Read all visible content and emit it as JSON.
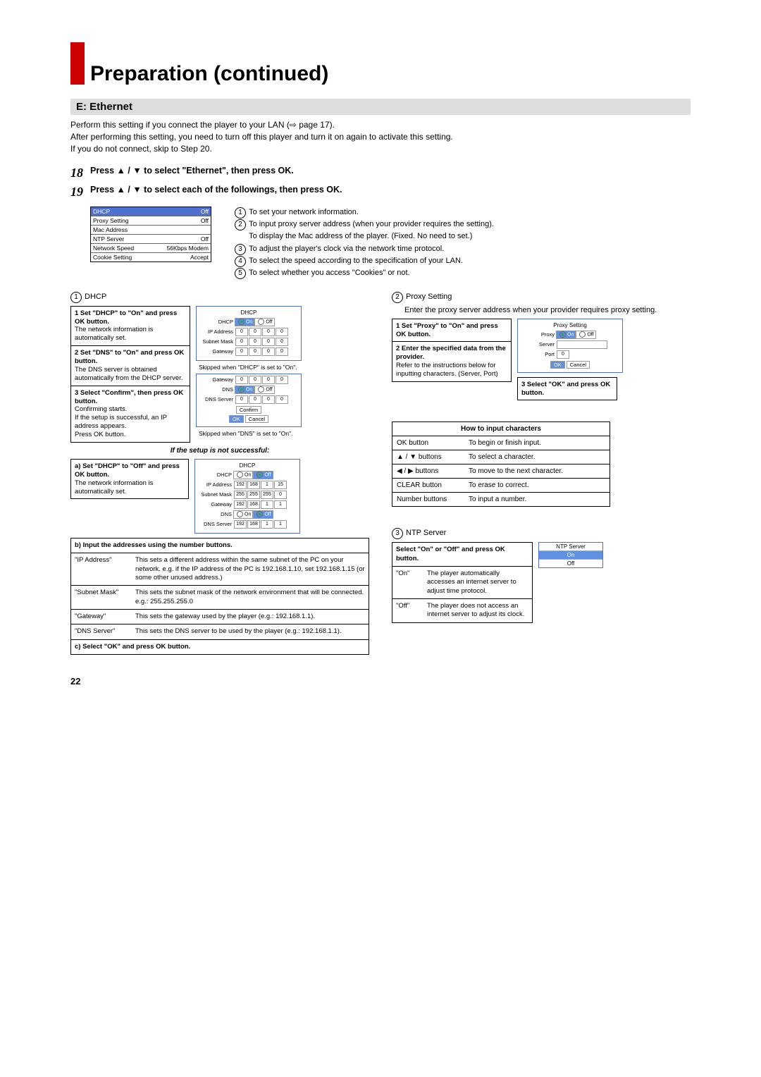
{
  "title": "Preparation (continued)",
  "section": "E: Ethernet",
  "intro": {
    "l1": "Perform this setting if you connect the player to your LAN (⇨ page 17).",
    "l2": "After performing this setting, you need to turn off this player and turn it on again to activate this setting.",
    "l3": "If you do not connect, skip to Step 20."
  },
  "step18": {
    "num": "18",
    "text": "Press ▲ / ▼ to select \"Ethernet\", then press OK."
  },
  "step19": {
    "num": "19",
    "text": "Press ▲ / ▼ to select each of the followings, then press OK."
  },
  "menu": {
    "rows": [
      {
        "l": "DHCP",
        "r": "Off"
      },
      {
        "l": "Proxy Setting",
        "r": "Off"
      },
      {
        "l": "Mac Address",
        "r": ""
      },
      {
        "l": "NTP Server",
        "r": "Off"
      },
      {
        "l": "Network Speed",
        "r": "56Kbps Modem"
      },
      {
        "l": "Cookie Setting",
        "r": "Accept"
      }
    ]
  },
  "desc": {
    "d1": "To set your network information.",
    "d2": "To input proxy server address (when your provider requires the setting).",
    "d_mac": "To display the Mac address of the player. (Fixed. No need to set.)",
    "d3": "To adjust the player's clock via the network time protocol.",
    "d4": "To select the speed according to the specification of your LAN.",
    "d5": "To select whether you access \"Cookies\" or not."
  },
  "dhcp": {
    "label": "DHCP",
    "s1_t": "1  Set \"DHCP\" to \"On\" and press OK button.",
    "s1_b": "The network information is automatically set.",
    "s2_t": "2  Set \"DNS\" to \"On\" and press OK button.",
    "s2_b": "The DNS server is obtained automatically from the DHCP server.",
    "s3_t": "3  Select \"Confirm\", then press OK button.",
    "s3_b": "Confirming starts.\nIf the setup is successful, an IP address appears.\nPress OK button.",
    "skip1": "Skipped when \"DHCP\" is set to \"On\".",
    "skip2": "Skipped when \"DNS\" is set to \"On\".",
    "fail_note": "If the setup is not successful:",
    "a_t": "a) Set \"DHCP\" to \"Off\" and press OK button.",
    "a_b": "The network information is automatically set.",
    "b_t": "b) Input the addresses using the number buttons.",
    "rows": {
      "ip_l": "\"IP Address\"",
      "ip_r": "This sets a different address within the same subnet of the PC on your network. e.g. if the IP address of the PC is 192.168.1.10, set 192.168.1.15 (or some other unused address.)",
      "sm_l": "\"Subnet Mask\"",
      "sm_r": "This sets the subnet mask of the network environment that will be connected. e.g.: 255.255.255.0",
      "gw_l": "\"Gateway\"",
      "gw_r": "This sets the gateway used by the player (e.g.: 192.168.1.1).",
      "dns_l": "\"DNS Server\"",
      "dns_r": "This sets the DNS server to be used by the player (e.g.: 192.168.1.1)."
    },
    "c_t": "c) Select \"OK\" and press OK button."
  },
  "proxy": {
    "label": "Proxy Setting",
    "intro": "Enter the proxy server address when your provider requires proxy setting.",
    "s1_t": "1  Set \"Proxy\" to \"On\" and press OK button.",
    "s2_t": "2  Enter the specified data from the provider.",
    "s2_b": "Refer to the instructions below for inputting characters. (Server, Port)",
    "s3_t": "3  Select \"OK\" and press OK button."
  },
  "input_chars": {
    "title": "How to input characters",
    "r1": {
      "l": "OK button",
      "r": "To begin or finish input."
    },
    "r2": {
      "l": "▲ / ▼ buttons",
      "r": "To select a character."
    },
    "r3": {
      "l": "◀ / ▶ buttons",
      "r": "To move to the next character."
    },
    "r4": {
      "l": "CLEAR button",
      "r": "To erase to correct."
    },
    "r5": {
      "l": "Number buttons",
      "r": "To input a number."
    }
  },
  "ntp": {
    "label": "NTP Server",
    "sel": "Select \"On\" or \"Off\" and press OK button.",
    "on_l": "\"On\"",
    "on_r": "The player automatically accesses an internet server to adjust time protocol.",
    "off_l": "\"Off\"",
    "off_r": "The player does not access an internet server to adjust its clock."
  },
  "osd_labels": {
    "dhcp": "DHCP",
    "ip": "IP Address",
    "sm": "Subnet Mask",
    "gw": "Gateway",
    "dns": "DNS",
    "dnss": "DNS Server",
    "on": "On",
    "off": "Off",
    "confirm": "Confirm",
    "ok": "OK",
    "cancel": "Cancel",
    "proxy_title": "Proxy Setting",
    "proxy": "Proxy",
    "server": "Server",
    "port": "Port",
    "ntp_title": "NTP Server"
  },
  "chart_data": {
    "type": "table",
    "title": "Ethernet settings menu",
    "categories": [
      "DHCP",
      "Proxy Setting",
      "Mac Address",
      "NTP Server",
      "Network Speed",
      "Cookie Setting"
    ],
    "values": [
      "Off",
      "Off",
      "",
      "Off",
      "56Kbps Modem",
      "Accept"
    ]
  },
  "ipvals": {
    "zero": "0",
    "192": "192",
    "168": "168",
    "v1": "1",
    "v15": "15",
    "v255": "255"
  },
  "pagenum": "22"
}
